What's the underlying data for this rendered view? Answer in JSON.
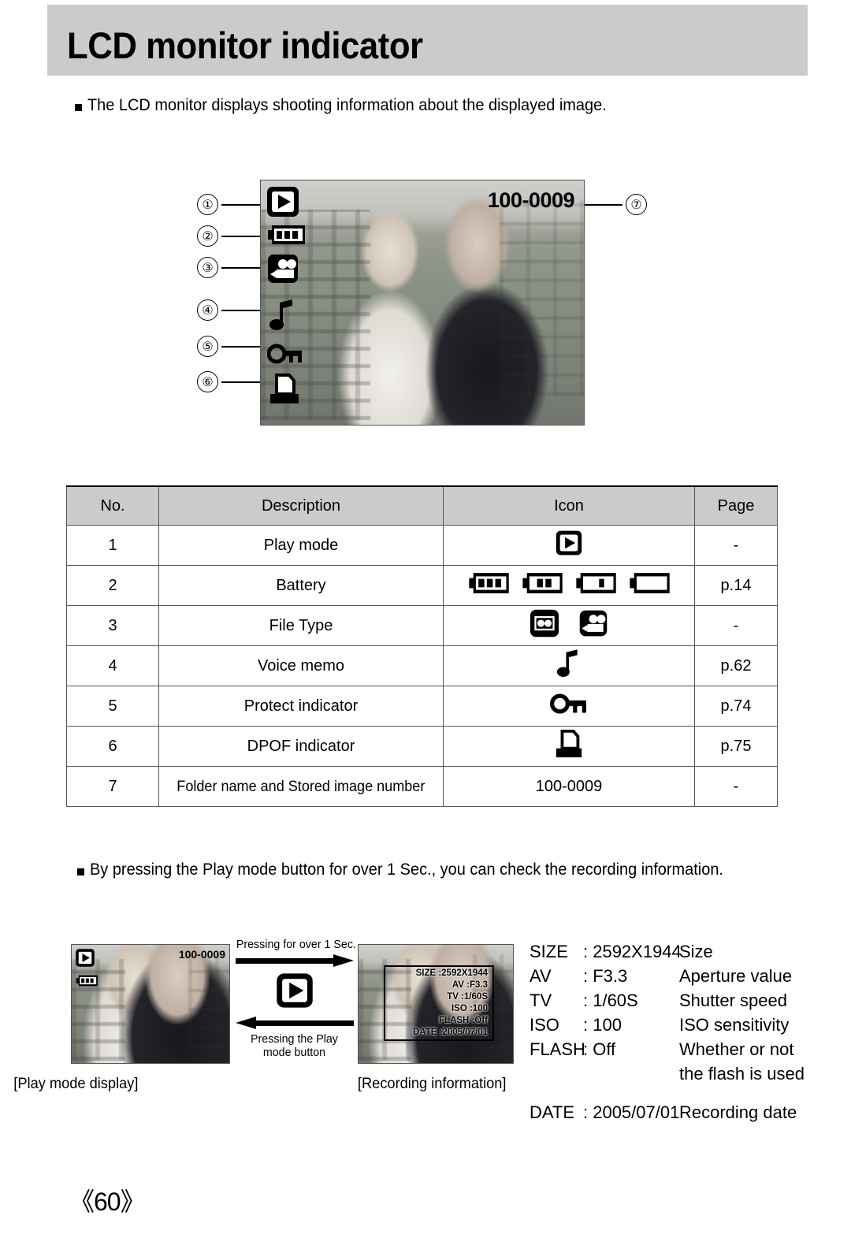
{
  "header": {
    "title": "LCD monitor indicator"
  },
  "intro": {
    "text": "The LCD monitor displays shooting information about the displayed image."
  },
  "lcd_display": {
    "folder_number": "100-0009",
    "callouts": [
      {
        "num": "①",
        "icon": "play-mode-icon"
      },
      {
        "num": "②",
        "icon": "battery-full-icon"
      },
      {
        "num": "③",
        "icon": "movie-clip-icon"
      },
      {
        "num": "④",
        "icon": "voice-memo-icon"
      },
      {
        "num": "⑤",
        "icon": "protect-key-icon"
      },
      {
        "num": "⑥",
        "icon": "dpof-printer-icon"
      },
      {
        "num": "⑦",
        "icon": "folder-number-label"
      }
    ]
  },
  "table": {
    "headers": [
      "No.",
      "Description",
      "Icon",
      "Page"
    ],
    "rows": [
      {
        "no": "1",
        "description": "Play mode",
        "icon_text": "",
        "page": "-"
      },
      {
        "no": "2",
        "description": "Battery",
        "icon_text": "",
        "page": "p.14"
      },
      {
        "no": "3",
        "description": "File Type",
        "icon_text": "",
        "page": "-"
      },
      {
        "no": "4",
        "description": "Voice memo",
        "icon_text": "",
        "page": "p.62"
      },
      {
        "no": "5",
        "description": "Protect indicator",
        "icon_text": "",
        "page": "p.74"
      },
      {
        "no": "6",
        "description": "DPOF indicator",
        "icon_text": "",
        "page": "p.75"
      },
      {
        "no": "7",
        "description": "Folder name and Stored image number",
        "icon_text": "100-0009",
        "page": "-"
      }
    ]
  },
  "play_info": {
    "text": "By pressing the Play mode button for over 1 Sec., you can check the recording information."
  },
  "flow": {
    "arrow_forward_label": "Pressing for over 1 Sec.",
    "arrow_back_label_line1": "Pressing the Play",
    "arrow_back_label_line2": "mode button",
    "caption_left": "[Play mode display]",
    "caption_right": "[Recording information]",
    "thumb_play": {
      "folder_number": "100-0009"
    },
    "thumb_rec": {
      "lines": [
        "SIZE :2592X1944",
        "AV :F3.3",
        "TV :1/60S",
        "ISO :100",
        "FLASH :Off",
        "DATE :2005/07/01"
      ]
    }
  },
  "legend": {
    "rows": [
      {
        "label": "SIZE",
        "sep": ": 2592X1944",
        "meaning": "Size"
      },
      {
        "label": "AV",
        "sep": ": F3.3",
        "meaning": "Aperture value"
      },
      {
        "label": "TV",
        "sep": ": 1/60S",
        "meaning": "Shutter speed"
      },
      {
        "label": "ISO",
        "sep": ": 100",
        "meaning": "ISO sensitivity"
      },
      {
        "label": "FLASH",
        "sep": ": Off",
        "meaning": "Whether or not"
      },
      {
        "label": "",
        "sep": "",
        "meaning": "the flash is used"
      },
      {
        "label": "DATE",
        "sep": ": 2005/07/01",
        "meaning": "Recording date"
      }
    ]
  },
  "footer": {
    "page_number": "《60》"
  }
}
